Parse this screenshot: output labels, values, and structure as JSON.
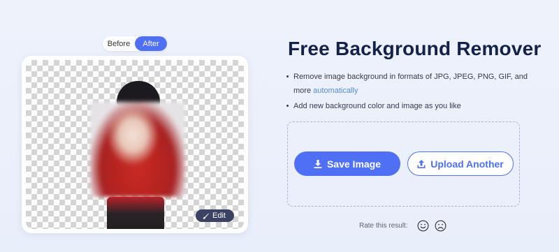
{
  "toggle": {
    "before_label": "Before",
    "after_label": "After",
    "selected": "After"
  },
  "preview": {
    "edit_label": "Edit"
  },
  "hero": {
    "title": "Free Background Remover"
  },
  "features": {
    "item1_text": "Remove image background in formats of JPG, JPEG, PNG, GIF, and more ",
    "item1_link": "automatically",
    "item2_text": "Add new background color and image as you like"
  },
  "actions": {
    "save_label": "Save Image",
    "upload_label": "Upload Another"
  },
  "rating": {
    "label": "Rate this result:"
  },
  "colors": {
    "accent": "#4f6ff5",
    "title": "#14224b",
    "edit_bg": "#3b4263",
    "link": "#4f8ce0"
  },
  "icons": {
    "edit": "brush-icon",
    "save": "download-icon",
    "upload": "upload-icon",
    "happy": "smiley-happy-icon",
    "sad": "smiley-sad-icon"
  }
}
